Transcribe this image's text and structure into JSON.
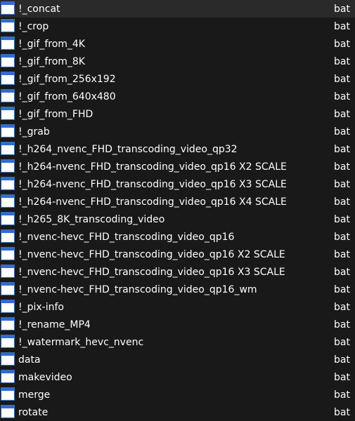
{
  "files": [
    {
      "name": "!_concat",
      "type": "bat",
      "icon": "batch-file-icon"
    },
    {
      "name": "!_crop",
      "type": "bat",
      "icon": "batch-file-icon"
    },
    {
      "name": "!_gif_from_4K",
      "type": "bat",
      "icon": "batch-file-icon"
    },
    {
      "name": "!_gif_from_8K",
      "type": "bat",
      "icon": "batch-file-icon"
    },
    {
      "name": "!_gif_from_256x192",
      "type": "bat",
      "icon": "batch-file-icon"
    },
    {
      "name": "!_gif_from_640x480",
      "type": "bat",
      "icon": "batch-file-icon"
    },
    {
      "name": "!_gif_from_FHD",
      "type": "bat",
      "icon": "batch-file-icon"
    },
    {
      "name": "!_grab",
      "type": "bat",
      "icon": "batch-file-icon"
    },
    {
      "name": "!_h264_nvenc_FHD_transcoding_video_qp32",
      "type": "bat",
      "icon": "batch-file-icon"
    },
    {
      "name": "!_h264-nvenc_FHD_transcoding_video_qp16 X2 SCALE",
      "type": "bat",
      "icon": "batch-file-icon"
    },
    {
      "name": "!_h264-nvenc_FHD_transcoding_video_qp16 X3 SCALE",
      "type": "bat",
      "icon": "batch-file-icon"
    },
    {
      "name": "!_h264-nvenc_FHD_transcoding_video_qp16 X4 SCALE",
      "type": "bat",
      "icon": "batch-file-icon"
    },
    {
      "name": "!_h265_8K_transcoding_video",
      "type": "bat",
      "icon": "batch-file-icon"
    },
    {
      "name": "!_nvenc-hevc_FHD_transcoding_video_qp16",
      "type": "bat",
      "icon": "batch-file-icon"
    },
    {
      "name": "!_nvenc-hevc_FHD_transcoding_video_qp16 X2 SCALE",
      "type": "bat",
      "icon": "batch-file-icon"
    },
    {
      "name": "!_nvenc-hevc_FHD_transcoding_video_qp16 X3 SCALE",
      "type": "bat",
      "icon": "batch-file-icon"
    },
    {
      "name": "!_nvenc-hevc_FHD_transcoding_video_qp16_wm",
      "type": "bat",
      "icon": "batch-file-icon"
    },
    {
      "name": "!_pix-info",
      "type": "bat",
      "icon": "batch-file-icon"
    },
    {
      "name": "!_rename_MP4",
      "type": "bat",
      "icon": "batch-file-icon"
    },
    {
      "name": "!_watermark_hevc_nvenc",
      "type": "bat",
      "icon": "batch-file-icon"
    },
    {
      "name": "data",
      "type": "bat",
      "icon": "batch-file-icon"
    },
    {
      "name": "makevideo",
      "type": "bat",
      "icon": "batch-file-icon"
    },
    {
      "name": "merge",
      "type": "bat",
      "icon": "batch-file-icon"
    },
    {
      "name": "rotate",
      "type": "bat",
      "icon": "batch-file-icon"
    }
  ]
}
